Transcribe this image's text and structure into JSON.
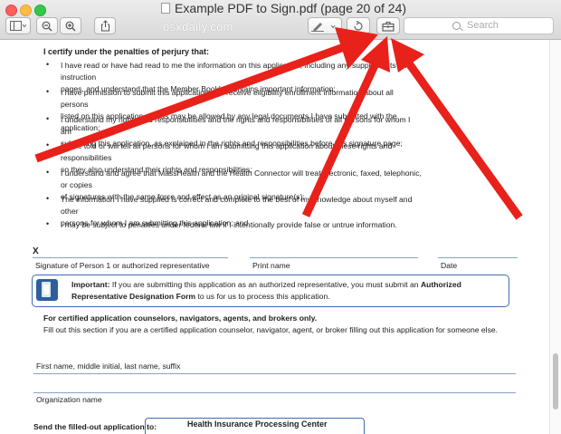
{
  "window": {
    "title": "Example PDF to Sign.pdf (page 20 of 24)",
    "watermark": "osxdaily.com"
  },
  "toolbar": {
    "search_placeholder": "Search"
  },
  "document": {
    "certify_heading": "I certify under the penalties of perjury that:",
    "bullets": [
      {
        "lines": [
          "I have read or have had read to me the information on this application, including any supplements and instruction",
          "pages, and understand that the Member Booklet contains important information;"
        ]
      },
      {
        "lines": [
          "I have permission to submit this application and receive eligibility enrollment information about all persons",
          "listed on this application and as may be allowed by any legal documents I have submitted with the application;"
        ]
      },
      {
        "lines": [
          "I understand my rights and responsibilities and the rights and responsibilities of all persons for whom I am",
          "submitting this application, as explained in the rights and responsibilities before this signature page;"
        ]
      },
      {
        "lines": [
          "I have told or will tell all persons for whom I am submitting this application about these rights and responsibilities",
          "so they also understand their rights and responsibilities;"
        ]
      },
      {
        "lines": [
          "I understand and agree that MassHealth and the Health Connector will treat electronic, faxed, telephonic, or copies",
          "of signatures with the same force and effect as an original signature(s);"
        ]
      },
      {
        "lines": [
          "The information I have supplied is correct and complete to the best of my knowledge about myself and other",
          "persons for whom I am submitting this application; and"
        ]
      },
      {
        "lines": [
          "I may be subject to penalties under federal law if I intentionally provide false or untrue information."
        ]
      }
    ],
    "x_mark": "X",
    "signature_labels": {
      "signature": "Signature of Person 1 or authorized representative",
      "print_name": "Print name",
      "date": "Date"
    },
    "notice": {
      "important": "Important:",
      "text1": " If you are submitting this application as an authorized representative, you must submit an ",
      "bold": "Authorized Representative Designation Form",
      "text2": " to us for us to process this application."
    },
    "certified": {
      "heading": "For certified application counselors, navigators, agents, and brokers only.",
      "text": "Fill out this section if you are a certified application counselor, navigator, agent, or broker filling out this application for someone else."
    },
    "fields": {
      "name": "First name, middle initial, last name, suffix",
      "organization": "Organization name"
    },
    "send_to": "Send the filled-out application to:",
    "hipc": "Health Insurance Processing Center"
  },
  "colors": {
    "arrow": "#e8211a",
    "form_blue": "#3d6db3"
  }
}
